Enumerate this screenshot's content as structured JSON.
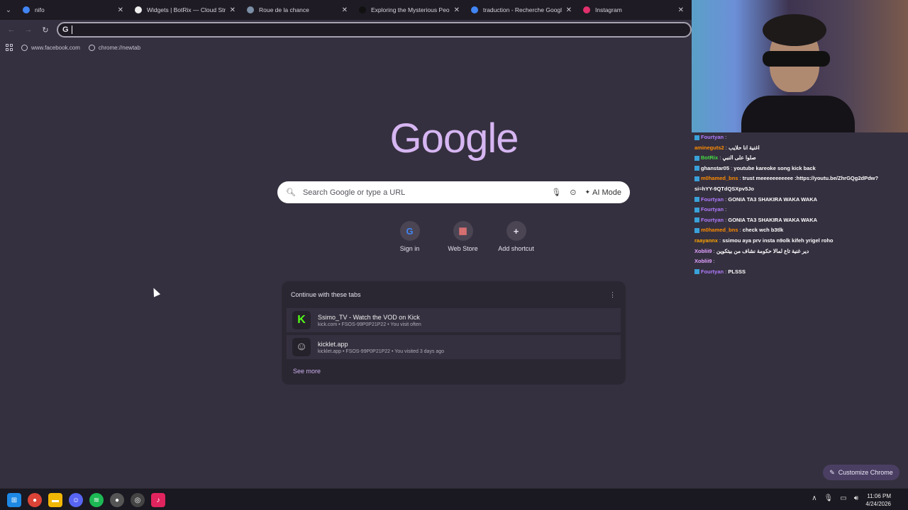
{
  "tabs": [
    {
      "label": "nifo",
      "favicon_color": "#4285f4"
    },
    {
      "label": "Widgets | BotRix — Cloud Strea",
      "favicon_color": "#eeeeee"
    },
    {
      "label": "Roue de la chance",
      "favicon_color": "#7b8fa6"
    },
    {
      "label": "Exploring the Mysterious Peopl",
      "favicon_color": "#111111"
    },
    {
      "label": "traduction - Recherche Google",
      "favicon_color": "#4285f4"
    },
    {
      "label": "Instagram",
      "favicon_color": "#e1306c"
    }
  ],
  "toolbar": {
    "omnibox_icon": "G",
    "omnibox_value": ""
  },
  "bookmarks": [
    {
      "label": "www.facebook.com"
    },
    {
      "label": "chrome://newtab"
    }
  ],
  "google": {
    "logo": "Google",
    "search_placeholder": "Search Google or type a URL",
    "ai_mode": "AI Mode"
  },
  "shortcuts": [
    {
      "label": "Sign in",
      "icon": "google-g-icon"
    },
    {
      "label": "Web Store",
      "icon": "web-store-icon"
    },
    {
      "label": "Add shortcut",
      "icon": "plus-icon"
    }
  ],
  "continue": {
    "title": "Continue with these tabs",
    "items": [
      {
        "title": "Ssimo_TV - Watch the VOD on Kick",
        "sub": "kick.com • FSOS-99P0P21P22 • You visit often",
        "icon": "K"
      },
      {
        "title": "kicklet.app",
        "sub": "kicklet.app • FSOS-99P0P21P22 • You visited 3 days ago",
        "icon": "☺"
      }
    ],
    "see_more": "See more"
  },
  "customize": "Customize Chrome",
  "chat": [
    {
      "user": "Fourtyan",
      "color": "#b07bff",
      "text": "",
      "badge": true
    },
    {
      "user": "amineguts2",
      "color": "#ff8c00",
      "text": "اغنية انا حلايب",
      "badge": false
    },
    {
      "user": "BotRix",
      "color": "#44dd44",
      "text": "صلوا على النبي",
      "badge": true
    },
    {
      "user": "ghanstar05",
      "color": "#ffffff",
      "text": "youtube kareoke song kick back",
      "badge": true
    },
    {
      "user": "m0hamed_bns",
      "color": "#ff8c00",
      "text": "trust meeeeeeeeeee :https://youtu.be/ZhrGQg2dPdw?",
      "badge": true
    },
    {
      "user": "",
      "color": "#ffffff",
      "text": "si=hYY-9QTdQSXpv5Jo",
      "badge": false
    },
    {
      "user": "Fourtyan",
      "color": "#b07bff",
      "text": "GONIA TA3 SHAKIRA WAKA WAKA",
      "badge": true
    },
    {
      "user": "Fourtyan",
      "color": "#b07bff",
      "text": "",
      "badge": true
    },
    {
      "user": "Fourtyan",
      "color": "#b07bff",
      "text": "GONIA TA3 SHAKIRA WAKA WAKA",
      "badge": true
    },
    {
      "user": "m0hamed_bns",
      "color": "#ff8c00",
      "text": "check wch b3tlk",
      "badge": true
    },
    {
      "user": "raayannx",
      "color": "#ffa500",
      "text": "ssimou aya prv insta n9olk kifeh yrigel roho",
      "badge": false
    },
    {
      "user": "Xoblii9",
      "color": "#e0a0ff",
      "text": "دير غنية تاع لمالا حكومة نشاف من بيتكوين",
      "badge": false
    },
    {
      "user": "Xoblii9",
      "color": "#e0a0ff",
      "text": "",
      "badge": false
    },
    {
      "user": "Fourtyan",
      "color": "#b07bff",
      "text": "PLSSS",
      "badge": true
    }
  ],
  "clock": {
    "time": "11:06 PM",
    "date": "4/24/2026"
  }
}
